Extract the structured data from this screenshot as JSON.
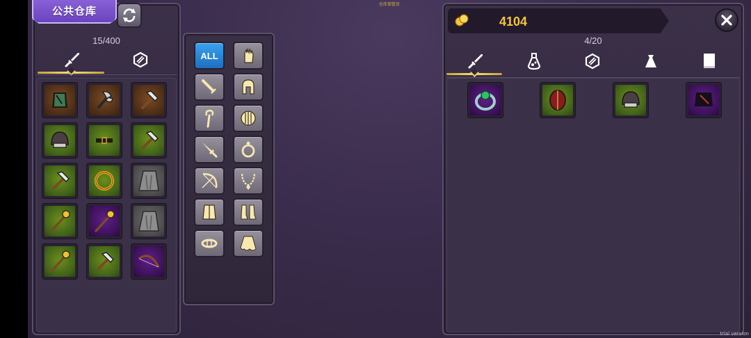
{
  "top_hint": "仓库保管员",
  "trial_text": "trial version",
  "storage": {
    "title": "公共仓库",
    "capacity": "15/400",
    "tabs": [
      {
        "icon": "sword-icon",
        "active": true
      },
      {
        "icon": "gem-icon",
        "active": false
      }
    ],
    "items": [
      {
        "icon": "chest-armor-icon",
        "rarity": "brown"
      },
      {
        "icon": "axe-icon",
        "rarity": "brown"
      },
      {
        "icon": "hammer-icon",
        "rarity": "brown"
      },
      {
        "icon": "helmet-icon",
        "rarity": "green"
      },
      {
        "icon": "belt-icon",
        "rarity": "green"
      },
      {
        "icon": "hammer-icon",
        "rarity": "green"
      },
      {
        "icon": "hammer-icon",
        "rarity": "green"
      },
      {
        "icon": "ring-icon",
        "rarity": "green"
      },
      {
        "icon": "cloak-icon",
        "rarity": "gray"
      },
      {
        "icon": "staff-icon",
        "rarity": "green"
      },
      {
        "icon": "staff-icon",
        "rarity": "purple"
      },
      {
        "icon": "cloak-icon",
        "rarity": "gray"
      },
      {
        "icon": "staff-icon",
        "rarity": "green"
      },
      {
        "icon": "hammer-icon",
        "rarity": "green"
      },
      {
        "icon": "bow-icon",
        "rarity": "purple"
      }
    ]
  },
  "filters": {
    "all_label": "ALL",
    "buttons": [
      {
        "id": "all",
        "icon": "all-icon"
      },
      {
        "id": "gloves",
        "icon": "glove-icon"
      },
      {
        "id": "sword",
        "icon": "sword-icon"
      },
      {
        "id": "helmet",
        "icon": "helmet-icon"
      },
      {
        "id": "staff",
        "icon": "staff-icon"
      },
      {
        "id": "shield",
        "icon": "shield-icon"
      },
      {
        "id": "dagger",
        "icon": "dagger-icon"
      },
      {
        "id": "ring",
        "icon": "ring-icon"
      },
      {
        "id": "bow",
        "icon": "bow-icon"
      },
      {
        "id": "necklace",
        "icon": "necklace-icon"
      },
      {
        "id": "armor",
        "icon": "armor-icon"
      },
      {
        "id": "boots",
        "icon": "boots-icon"
      },
      {
        "id": "belt",
        "icon": "belt-icon"
      },
      {
        "id": "cape",
        "icon": "cape-icon"
      }
    ]
  },
  "bag": {
    "gold": "4104",
    "count": "4/20",
    "tabs": [
      {
        "icon": "sword-icon",
        "active": true
      },
      {
        "icon": "potion-icon",
        "active": false
      },
      {
        "icon": "gem-icon",
        "active": false
      },
      {
        "icon": "bag-icon",
        "active": false
      },
      {
        "icon": "book-icon",
        "active": false
      }
    ],
    "items": [
      {
        "icon": "emerald-ring-icon",
        "rarity": "purple"
      },
      {
        "icon": "round-shield-icon",
        "rarity": "green"
      },
      {
        "icon": "helmet-icon",
        "rarity": "green"
      },
      {
        "icon": "dark-armor-icon",
        "rarity": "purple"
      }
    ]
  },
  "colors": {
    "accent_gold": "#f4c53a",
    "active_filter": "#2a86d8",
    "ribbon": "#7a52cc"
  }
}
